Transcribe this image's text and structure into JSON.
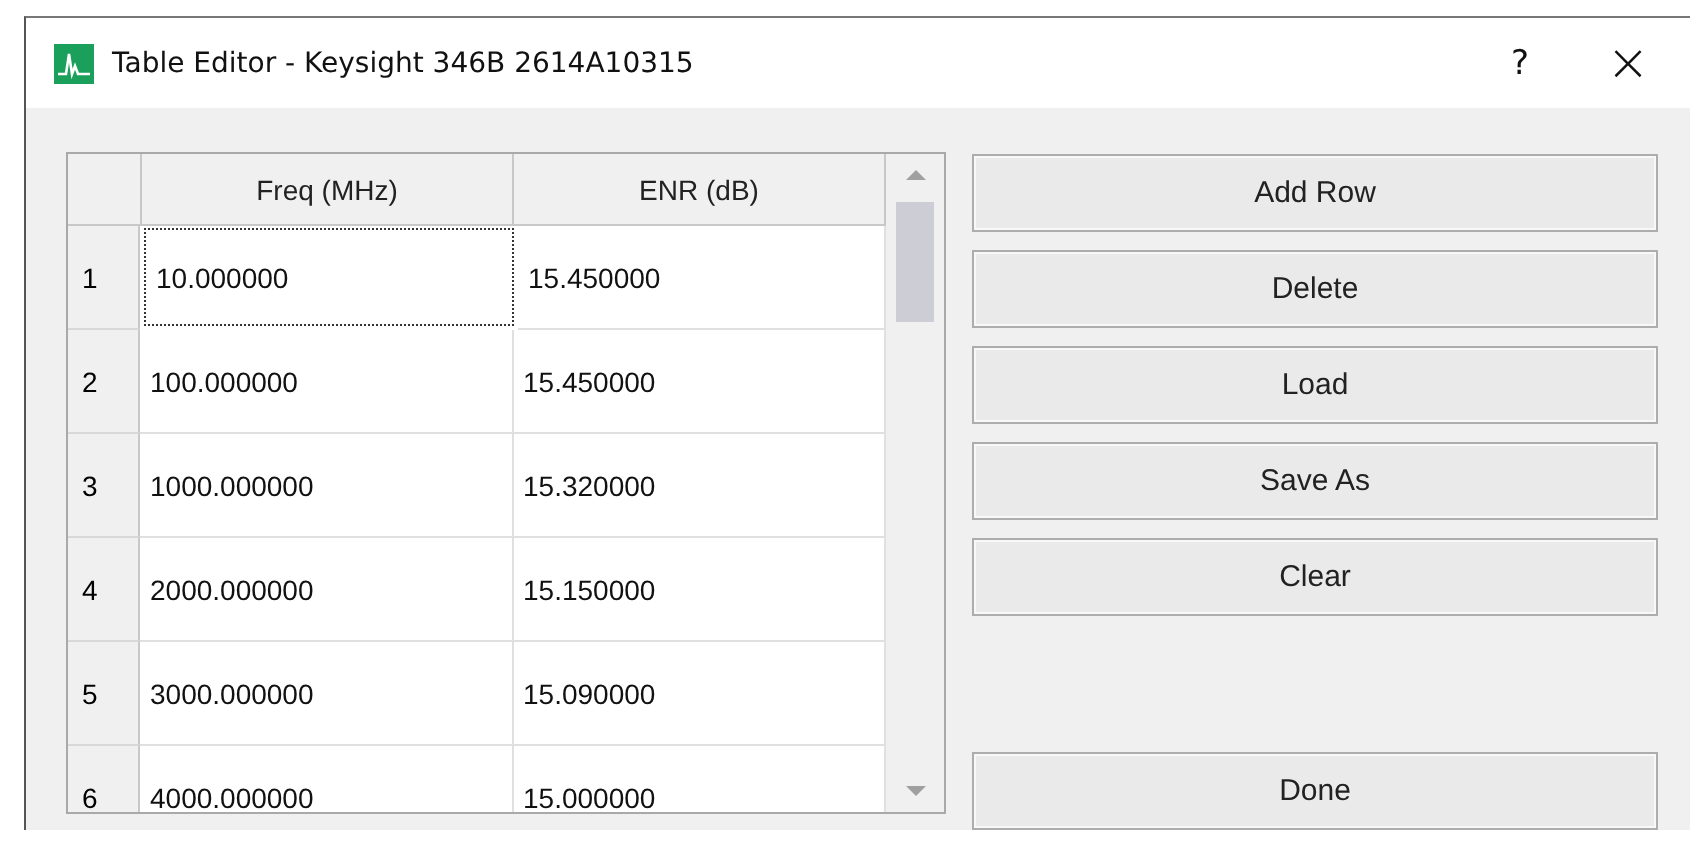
{
  "window": {
    "title": "Table Editor - Keysight 346B 2614A10315",
    "help": "?",
    "close": "×"
  },
  "table": {
    "columns": [
      "Freq (MHz)",
      "ENR (dB)"
    ],
    "rows": [
      {
        "number": "1",
        "freq": "10.000000",
        "enr": "15.450000",
        "focused": true
      },
      {
        "number": "2",
        "freq": "100.000000",
        "enr": "15.450000",
        "focused": false
      },
      {
        "number": "3",
        "freq": "1000.000000",
        "enr": "15.320000",
        "focused": false
      },
      {
        "number": "4",
        "freq": "2000.000000",
        "enr": "15.150000",
        "focused": false
      },
      {
        "number": "5",
        "freq": "3000.000000",
        "enr": "15.090000",
        "focused": false
      },
      {
        "number": "6",
        "freq": "4000.000000",
        "enr": "15.000000",
        "focused": false
      }
    ]
  },
  "buttons": [
    {
      "label": "Add Row",
      "kind": "top"
    },
    {
      "label": "Delete",
      "kind": "top"
    },
    {
      "label": "Load",
      "kind": "top"
    },
    {
      "label": "Save As",
      "kind": "top"
    },
    {
      "label": "Clear",
      "kind": "top"
    },
    {
      "label": "Done",
      "kind": "bottom"
    }
  ]
}
